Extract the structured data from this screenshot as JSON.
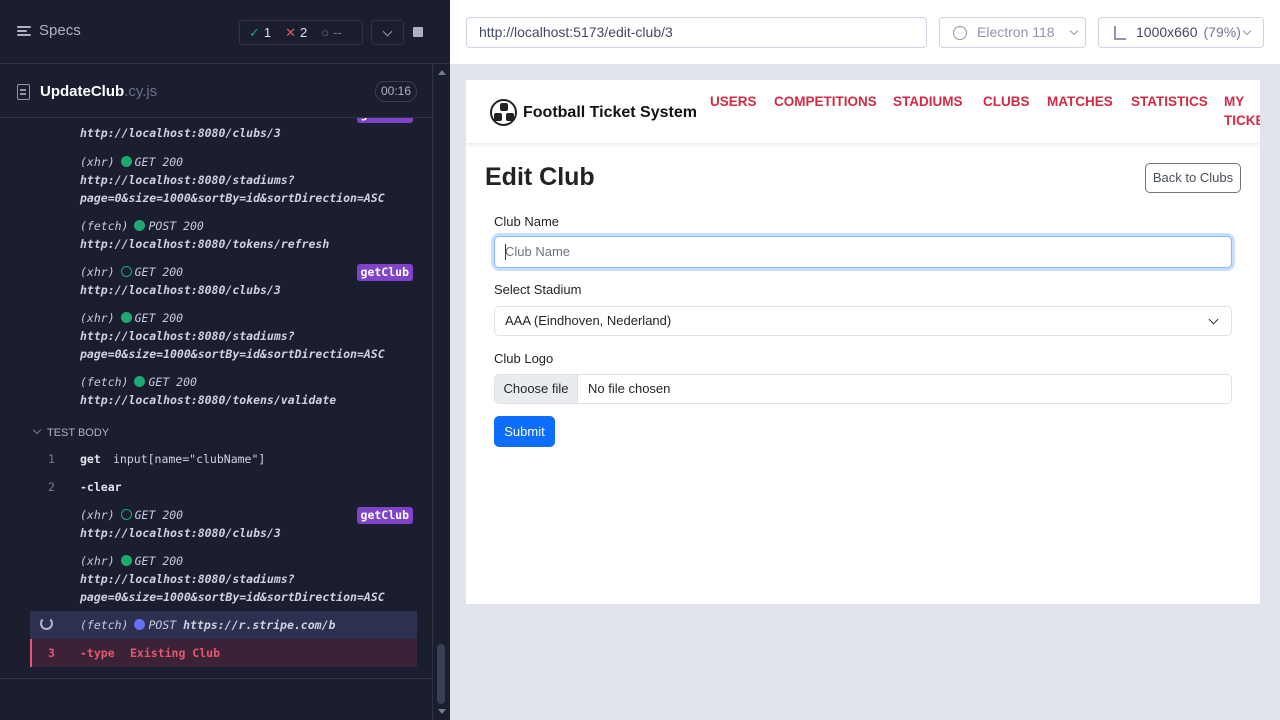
{
  "runner": {
    "specs_label": "Specs",
    "passed": "1",
    "failed": "2",
    "pending": "--",
    "file_name": "UpdateClub",
    "file_ext": ".cy.js",
    "timer": "00:16"
  },
  "log": {
    "top_entries": [
      {
        "kind": "",
        "method": "",
        "url": "http://localhost:8080/clubs/3",
        "url2": "",
        "tag": "getClub"
      },
      {
        "kind": "(xhr)",
        "method": "GET 200",
        "url": "http://localhost:8080/stadiums?",
        "url2": "page=0&size=1000&sortBy=id&sortDirection=ASC",
        "tag": ""
      },
      {
        "kind": "(fetch)",
        "method": "POST 200",
        "url": "http://localhost:8080/tokens/refresh",
        "url2": "",
        "tag": ""
      },
      {
        "kind": "(xhr)",
        "method": "GET 200",
        "url": "http://localhost:8080/clubs/3",
        "url2": "",
        "tag": "getClub"
      },
      {
        "kind": "(xhr)",
        "method": "GET 200",
        "url": "http://localhost:8080/stadiums?",
        "url2": "page=0&size=1000&sortBy=id&sortDirection=ASC",
        "tag": ""
      },
      {
        "kind": "(fetch)",
        "method": "GET 200",
        "url": "http://localhost:8080/tokens/validate",
        "url2": "",
        "tag": ""
      }
    ],
    "test_body_label": "TEST BODY",
    "cmd1": {
      "num": "1",
      "name": "get",
      "arg": "input[name=\"clubName\"]"
    },
    "cmd2": {
      "num": "2",
      "name": "-clear"
    },
    "body_entries": [
      {
        "kind": "(xhr)",
        "method": "GET 200",
        "url": "http://localhost:8080/clubs/3",
        "url2": "",
        "tag": "getClub"
      },
      {
        "kind": "(xhr)",
        "method": "GET 200",
        "url": "http://localhost:8080/stadiums?",
        "url2": "page=0&size=1000&sortBy=id&sortDirection=ASC",
        "tag": ""
      }
    ],
    "running": {
      "kind": "(fetch)",
      "method": "POST",
      "url": "https://r.stripe.com/b"
    },
    "cmd3": {
      "num": "3",
      "name": "-type",
      "arg": "Existing Club"
    }
  },
  "browser": {
    "url": "http://localhost:5173/edit-club/3",
    "browser_name": "Electron 118",
    "viewport": "1000x660",
    "scale": "(79%)"
  },
  "app": {
    "brand": "Football Ticket System",
    "nav": [
      "USERS",
      "COMPETITIONS",
      "STADIUMS",
      "CLUBS",
      "MATCHES",
      "STATISTICS",
      "MY",
      "TICKETS"
    ],
    "title": "Edit Club",
    "back_label": "Back to Clubs",
    "club_name_label": "Club Name",
    "club_name_placeholder": "Club Name",
    "stadium_label": "Select Stadium",
    "stadium_value": "AAA (Eindhoven, Nederland)",
    "logo_label": "Club Logo",
    "choose_file": "Choose file",
    "no_file": "No file chosen",
    "submit_label": "Submit"
  }
}
